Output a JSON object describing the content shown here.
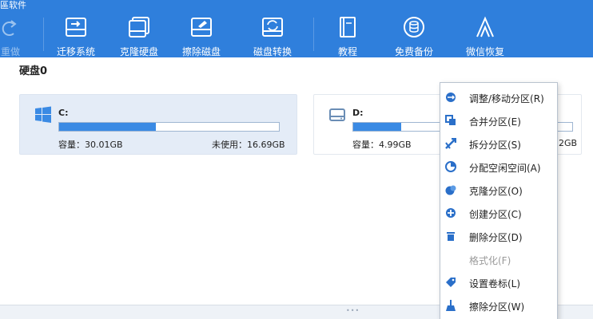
{
  "window": {
    "title_fragment": "區软件"
  },
  "toolbar": {
    "buttons": [
      {
        "id": "redo",
        "label": "重做",
        "icon": "redo-icon",
        "disabled": true
      },
      {
        "id": "migrate-os",
        "label": "迁移系统",
        "icon": "migrate-disk-icon"
      },
      {
        "id": "clone-disk",
        "label": "克隆硬盘",
        "icon": "clone-disk-icon"
      },
      {
        "id": "wipe-disk",
        "label": "擦除磁盘",
        "icon": "wipe-disk-icon"
      },
      {
        "id": "convert-disk",
        "label": "磁盘转换",
        "icon": "convert-disk-icon"
      },
      {
        "id": "tutorial",
        "label": "教程",
        "icon": "book-icon"
      },
      {
        "id": "free-backup",
        "label": "免费备份",
        "icon": "backup-database-icon"
      },
      {
        "id": "wechat-recovery",
        "label": "微信恢复",
        "icon": "recovery-icon"
      }
    ]
  },
  "disk": {
    "label": "硬盘0",
    "partitions": [
      {
        "name": "C:",
        "capacity_label": "容量：30.01GB",
        "unused_label": "未使用：16.69GB",
        "used_fraction": 0.44,
        "selected": true,
        "icon": "windows-logo-icon"
      },
      {
        "name": "D:",
        "capacity_label": "容量：4.99GB",
        "unused_label": "2GB",
        "used_fraction": 0.22,
        "selected": false,
        "icon": "drive-icon"
      }
    ]
  },
  "context_menu": {
    "items": [
      {
        "label": "调整/移动分区(R)",
        "icon": "resize-partition-icon",
        "disabled": false
      },
      {
        "label": "合并分区(E)",
        "icon": "merge-partition-icon",
        "disabled": false
      },
      {
        "label": "拆分分区(S)",
        "icon": "split-partition-icon",
        "disabled": false
      },
      {
        "label": "分配空闲空间(A)",
        "icon": "allocate-space-icon",
        "disabled": false
      },
      {
        "label": "克隆分区(O)",
        "icon": "clone-partition-icon",
        "disabled": false
      },
      {
        "label": "创建分区(C)",
        "icon": "create-partition-icon",
        "disabled": false
      },
      {
        "label": "删除分区(D)",
        "icon": "trash-icon",
        "disabled": false
      },
      {
        "label": "格式化(F)",
        "icon": "",
        "disabled": true
      },
      {
        "label": "设置卷标(L)",
        "icon": "tag-icon",
        "disabled": false
      },
      {
        "label": "擦除分区(W)",
        "icon": "broom-icon",
        "disabled": false
      }
    ]
  },
  "colors": {
    "toolbar_bg": "#2f7fdc",
    "accent": "#3a8ae4",
    "selected_card": "#e4ecf7",
    "menu_icon": "#2a6fc9"
  }
}
